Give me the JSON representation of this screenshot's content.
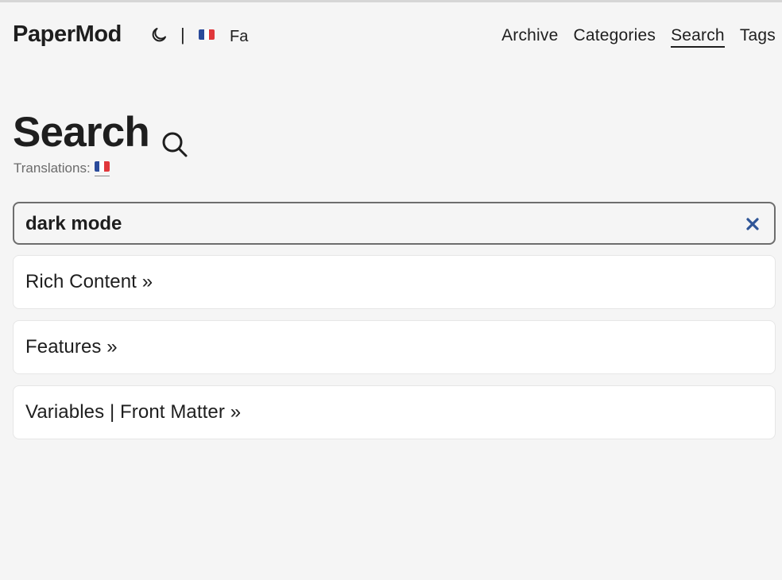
{
  "header": {
    "logo": "PaperMod",
    "separator": "|",
    "language_label": "Fa",
    "menu": [
      {
        "label": "Archive"
      },
      {
        "label": "Categories"
      },
      {
        "label": "Search",
        "active": true
      },
      {
        "label": "Tags"
      }
    ]
  },
  "page": {
    "title": "Search",
    "translations_label": "Translations:"
  },
  "search": {
    "value": "dark mode"
  },
  "results": [
    {
      "title": "Rich Content »"
    },
    {
      "title": "Features »"
    },
    {
      "title": "Variables | Front Matter »"
    }
  ],
  "icons": {
    "theme_toggle": "moon-icon",
    "title_search": "search-icon",
    "clear": "close-icon",
    "language_flag": "france-flag-icon"
  },
  "colors": {
    "background": "#f5f5f5",
    "text": "#1e1e1e",
    "clear_icon": "#2f5597",
    "card": "#ffffff"
  }
}
